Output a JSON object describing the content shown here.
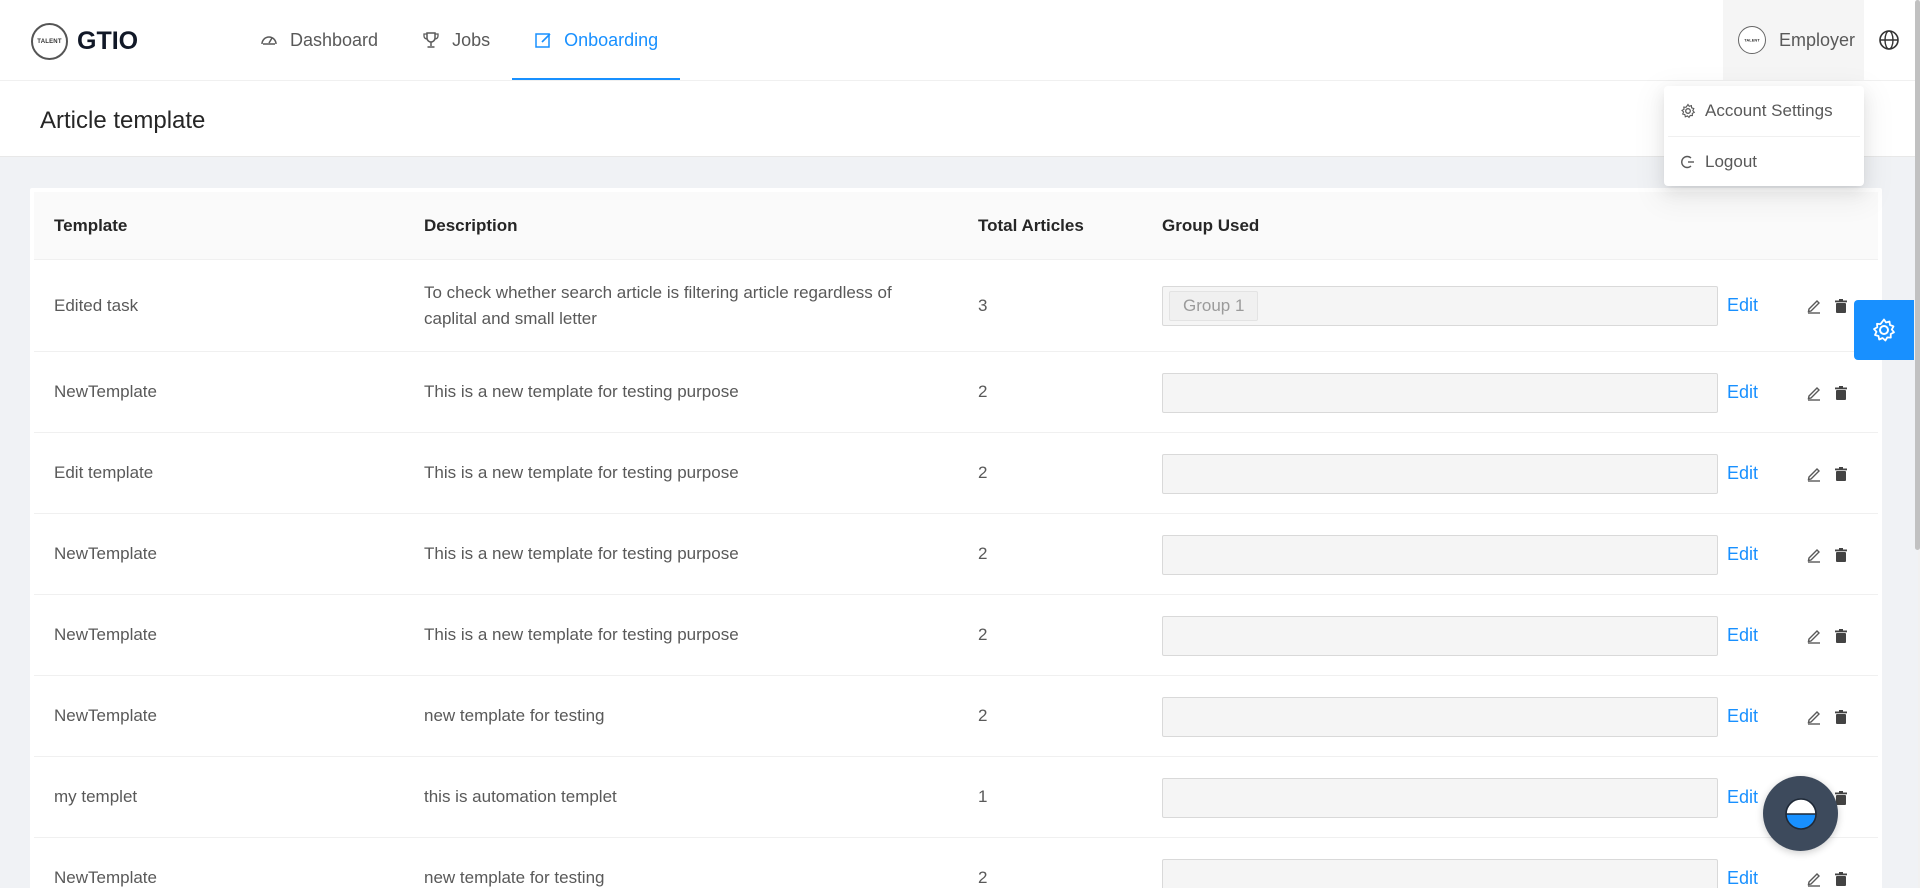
{
  "brand": {
    "name": "GTIO",
    "logo_text": "TALENT"
  },
  "nav": {
    "items": [
      {
        "label": "Dashboard",
        "icon": "dashboard-icon"
      },
      {
        "label": "Jobs",
        "icon": "trophy-icon"
      },
      {
        "label": "Onboarding",
        "icon": "edit-icon",
        "active": true
      }
    ]
  },
  "user": {
    "label": "Employer",
    "avatar_text": "TALENT"
  },
  "dropdown": {
    "items": [
      {
        "label": "Account Settings",
        "icon": "gear-icon"
      },
      {
        "label": "Logout",
        "icon": "logout-icon"
      }
    ]
  },
  "page": {
    "title": "Article template"
  },
  "table": {
    "headers": {
      "template": "Template",
      "description": "Description",
      "total": "Total Articles",
      "group": "Group Used"
    },
    "edit_label": "Edit",
    "rows": [
      {
        "template": "Edited task",
        "description": "To check whether search article is filtering article regardless of caplital and small letter",
        "total": "3",
        "groups": [
          "Group 1"
        ]
      },
      {
        "template": "NewTemplate",
        "description": "This is a new template for testing purpose",
        "total": "2",
        "groups": []
      },
      {
        "template": "Edit template",
        "description": "This is a new template for testing purpose",
        "total": "2",
        "groups": []
      },
      {
        "template": "NewTemplate",
        "description": "This is a new template for testing purpose",
        "total": "2",
        "groups": []
      },
      {
        "template": "NewTemplate",
        "description": "This is a new template for testing purpose",
        "total": "2",
        "groups": []
      },
      {
        "template": "NewTemplate",
        "description": "new template for testing",
        "total": "2",
        "groups": []
      },
      {
        "template": "my templet",
        "description": "this is automation templet",
        "total": "1",
        "groups": []
      },
      {
        "template": "NewTemplate",
        "description": "new template for testing",
        "total": "2",
        "groups": []
      }
    ]
  },
  "colors": {
    "primary": "#1890ff",
    "fab": "#3d4a5c"
  }
}
